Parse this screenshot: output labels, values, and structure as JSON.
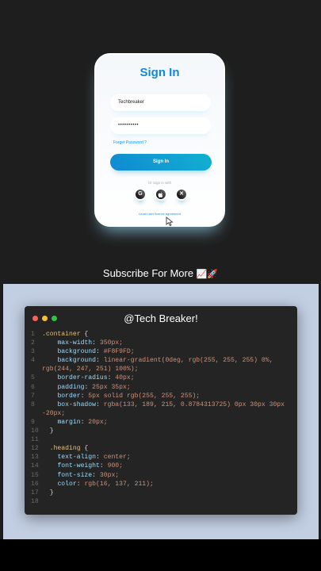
{
  "card": {
    "title": "Sign In",
    "username_value": "Techbreaker",
    "password_value": "••••••••••",
    "forgot_label": "Forget Password ?",
    "signin_label": "Sign In",
    "or_text": "Or Sign in with",
    "social": [
      "google-icon",
      "apple-icon",
      "x-icon"
    ],
    "agreement_label": "Learn user licence agreement"
  },
  "subscribe_text": "Subscribe For More",
  "subscribe_emoji": "📈🚀",
  "editor": {
    "title": "@Tech Breaker!",
    "lines": [
      {
        "n": "1",
        "t": ".container {"
      },
      {
        "n": "2",
        "t": "    max-width: 350px;"
      },
      {
        "n": "3",
        "t": "    background: #F8F9FD;"
      },
      {
        "n": "4",
        "t": "    background: linear-gradient(0deg, rgb(255, 255, 255) 0%, rgb(244, 247, 251) 100%);"
      },
      {
        "n": "5",
        "t": "    border-radius: 40px;"
      },
      {
        "n": "6",
        "t": "    padding: 25px 35px;"
      },
      {
        "n": "7",
        "t": "    border: 5px solid rgb(255, 255, 255);"
      },
      {
        "n": "8",
        "t": "    box-shadow: rgba(133, 189, 215, 0.8784313725) 0px 30px 30px -20px;"
      },
      {
        "n": "9",
        "t": "    margin: 20px;"
      },
      {
        "n": "10",
        "t": "  }"
      },
      {
        "n": "11",
        "t": ""
      },
      {
        "n": "12",
        "t": "  .heading {"
      },
      {
        "n": "13",
        "t": "    text-align: center;"
      },
      {
        "n": "14",
        "t": "    font-weight: 900;"
      },
      {
        "n": "15",
        "t": "    font-size: 30px;"
      },
      {
        "n": "16",
        "t": "    color: rgb(16, 137, 211);"
      },
      {
        "n": "17",
        "t": "  }"
      },
      {
        "n": "18",
        "t": ""
      }
    ]
  },
  "colors": {
    "accent": "#1089d3",
    "link": "#0099ff",
    "code_bg": "#242424"
  }
}
